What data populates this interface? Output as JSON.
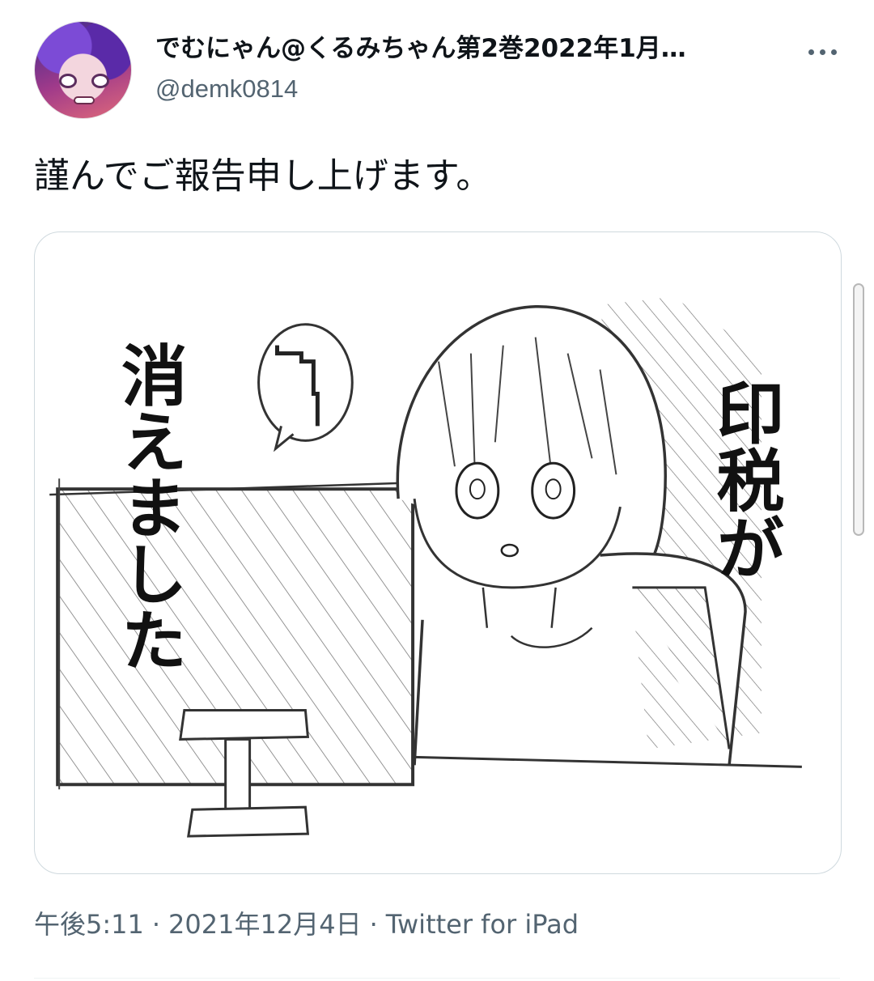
{
  "user": {
    "display_name": "でむにゃん@くるみちゃん第2巻2022年1月…",
    "handle": "@demk0814",
    "avatar_icon": "avatar-anime-girl"
  },
  "tweet": {
    "text": "謹んでご報告申し上げます。"
  },
  "media": {
    "caption_right": "印税が",
    "caption_left": "消えました"
  },
  "meta": {
    "time": "午後5:11",
    "date": "2021年12月4日",
    "source": "Twitter for iPad",
    "separator": "·"
  },
  "icons": {
    "more": "more-horizontal-icon"
  },
  "colors": {
    "text_primary": "#0f1419",
    "text_secondary": "#536471",
    "border": "#cfd9de"
  }
}
